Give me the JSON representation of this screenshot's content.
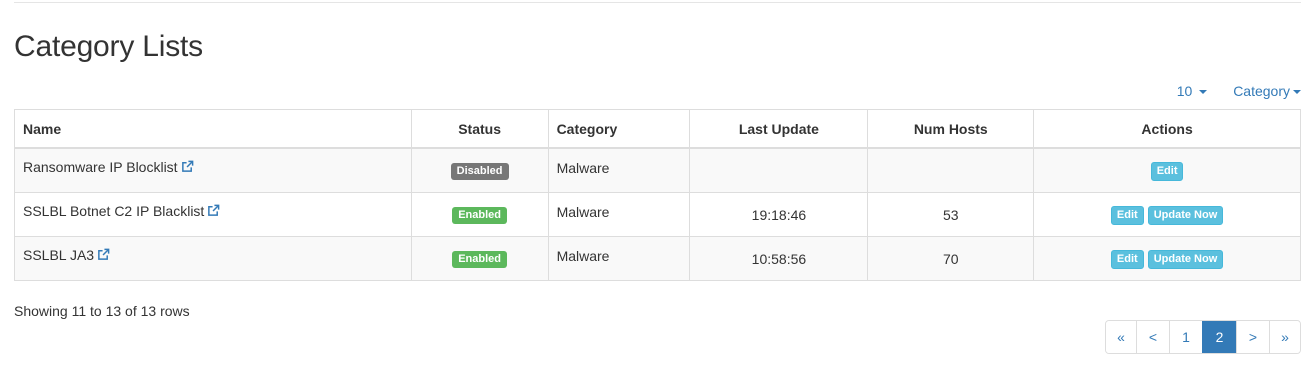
{
  "page": {
    "title": "Category Lists"
  },
  "toolbar": {
    "page_size": "10",
    "category_filter": "Category"
  },
  "table": {
    "headers": [
      "Name",
      "Status",
      "Category",
      "Last Update",
      "Num Hosts",
      "Actions"
    ],
    "rows": [
      {
        "name": "Ransomware IP Blocklist",
        "status": "Disabled",
        "category": "Malware",
        "last_update": "",
        "num_hosts": "",
        "actions": [
          "Edit"
        ]
      },
      {
        "name": "SSLBL Botnet C2 IP Blacklist",
        "status": "Enabled",
        "category": "Malware",
        "last_update": "19:18:46",
        "num_hosts": "53",
        "actions": [
          "Edit",
          "Update Now"
        ]
      },
      {
        "name": "SSLBL JA3",
        "status": "Enabled",
        "category": "Malware",
        "last_update": "10:58:56",
        "num_hosts": "70",
        "actions": [
          "Edit",
          "Update Now"
        ]
      }
    ]
  },
  "footer": {
    "info": "Showing 11 to 13 of 13 rows"
  },
  "pagination": {
    "first": "«",
    "prev": "<",
    "pages": [
      "1",
      "2"
    ],
    "current": "2",
    "next": ">",
    "last": "»"
  },
  "colors": {
    "link": "#337ab7",
    "enabled": "#5cb85c",
    "disabled": "#777777",
    "action": "#5bc0de"
  }
}
